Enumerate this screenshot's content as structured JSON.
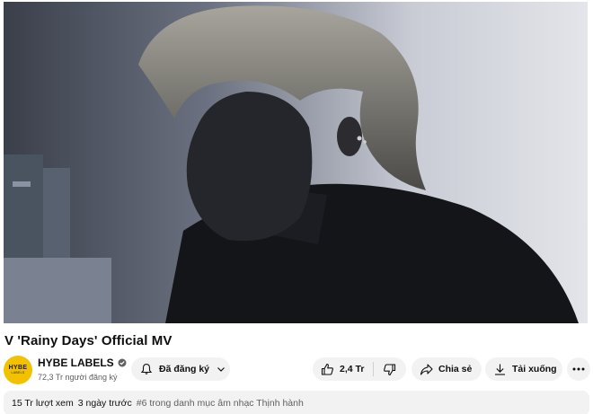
{
  "video": {
    "title": "V 'Rainy Days' Official MV"
  },
  "channel": {
    "avatar_text": "HYBE",
    "avatar_subtext": "LABELS",
    "name": "HYBE LABELS",
    "verified_icon": "verified-check-icon",
    "subscribers": "72,3 Tr người đăng ký"
  },
  "actions": {
    "subscribe_label": "Đã đăng ký",
    "like_count": "2,4 Tr",
    "share_label": "Chia sẻ",
    "download_label": "Tải xuống"
  },
  "description": {
    "views": "15 Tr lượt xem",
    "time": "3 ngày trước",
    "trending": "#6 trong danh mục âm nhạc Thịnh hành"
  },
  "colors": {
    "avatar_bg": "#f2c200",
    "pill_bg": "#f2f2f2",
    "secondary_text": "#606060"
  }
}
